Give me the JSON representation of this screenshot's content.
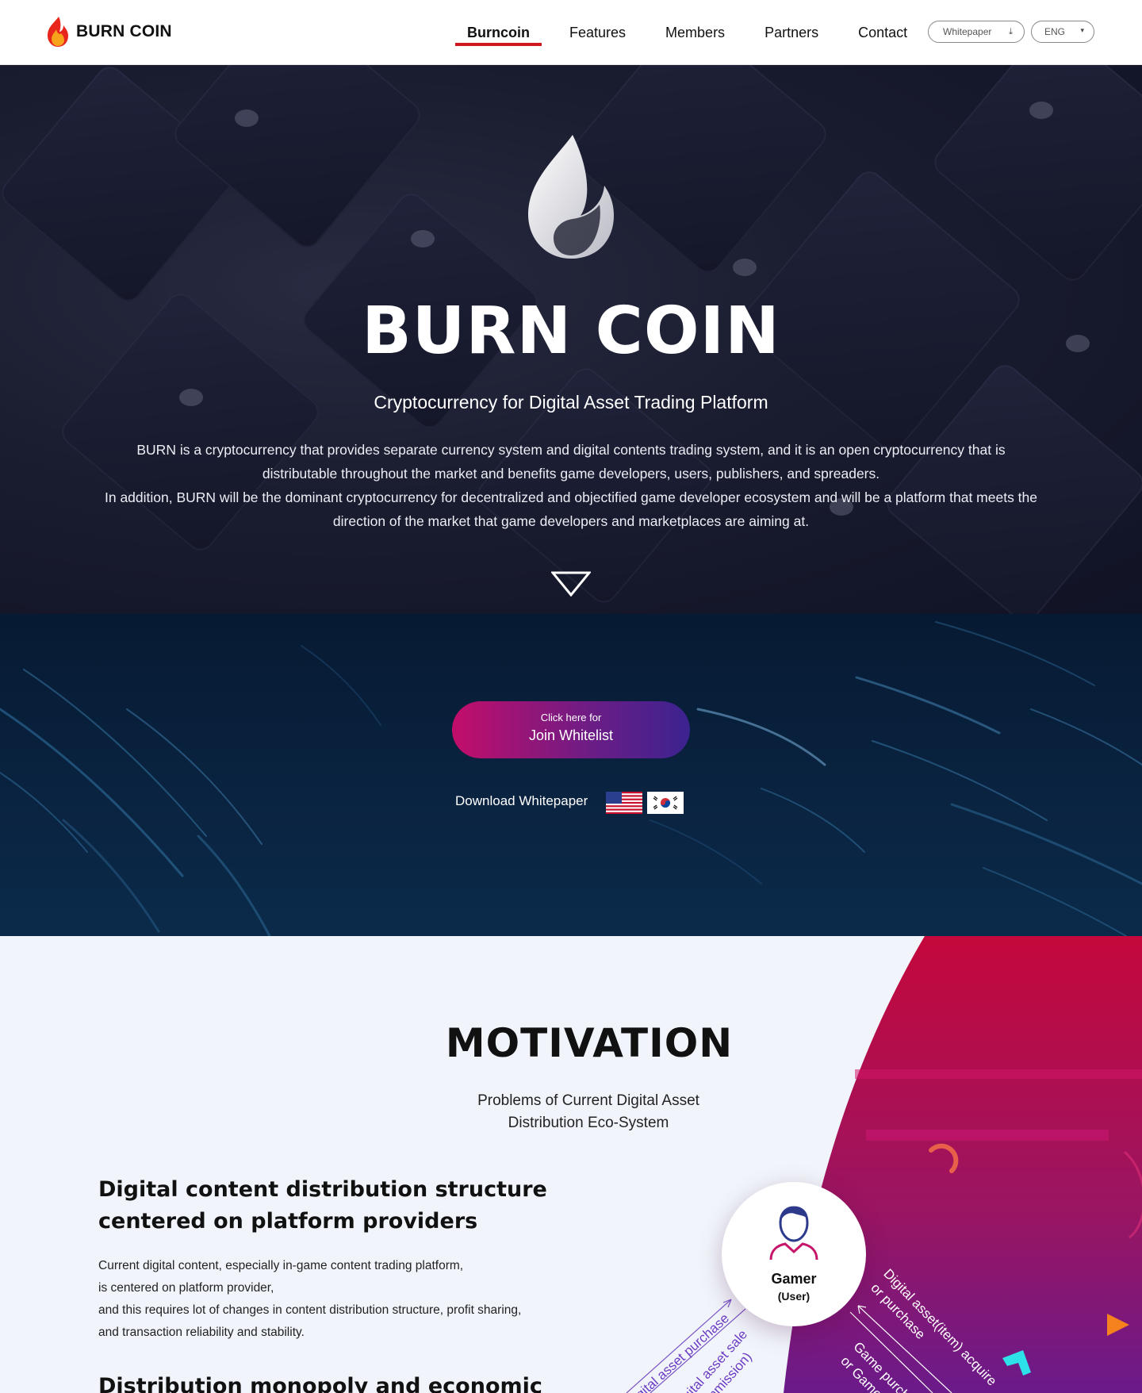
{
  "nav": {
    "brand": "BURN COIN",
    "items": [
      "Burncoin",
      "Features",
      "Members",
      "Partners",
      "Contact"
    ],
    "active_index": 0,
    "whitepaper_label": "Whitepaper",
    "language_label": "ENG"
  },
  "hero": {
    "title": "BURN COIN",
    "subtitle": "Cryptocurrency for Digital Asset Trading Platform",
    "description_1": "BURN is a cryptocurrency that provides separate currency system and digital contents trading system, and it is an open cryptocurrency that is distributable throughout the market and benefits game developers, users, publishers, and spreaders.",
    "description_2": "In addition, BURN will be the dominant cryptocurrency for decentralized and objectified game developer ecosystem and will be a platform that meets the direction of the market that game developers and marketplaces are aiming at."
  },
  "whitelist": {
    "small_label": "Click here for",
    "big_label": "Join Whitelist",
    "download_label": "Download Whitepaper"
  },
  "motivation": {
    "title": "MOTIVATION",
    "subtitle_1": "Problems of Current Digital Asset",
    "subtitle_2": "Distribution Eco-System",
    "heading_1_line1": "Digital content distribution structure",
    "heading_1_line2": "centered on platform providers",
    "paragraph_lines": [
      "Current digital content, especially in-game content trading platform,",
      "is centered on platform provider,",
      "and this requires lot of changes in content distribution structure, profit sharing,",
      "and transaction reliability and stability."
    ],
    "heading_2": "Distribution monopoly and economic",
    "diagram": {
      "gamer_label": "Gamer",
      "gamer_sub": "(User)",
      "arrow_purchase": "Digital asset purchase",
      "arrow_sale_1": "Digital asset sale",
      "arrow_sale_2": "(commission)",
      "arrow_acquire_1": "Digital asset(item) acquire",
      "arrow_acquire_2": "or purchase",
      "arrow_game_1": "Game purchase",
      "arrow_game_2": "or Game play"
    }
  },
  "colors": {
    "accent_red": "#d0161e",
    "whitelist_start": "#c30e6a",
    "whitelist_end": "#3b2390",
    "motivation_shape": "#b5104f"
  }
}
